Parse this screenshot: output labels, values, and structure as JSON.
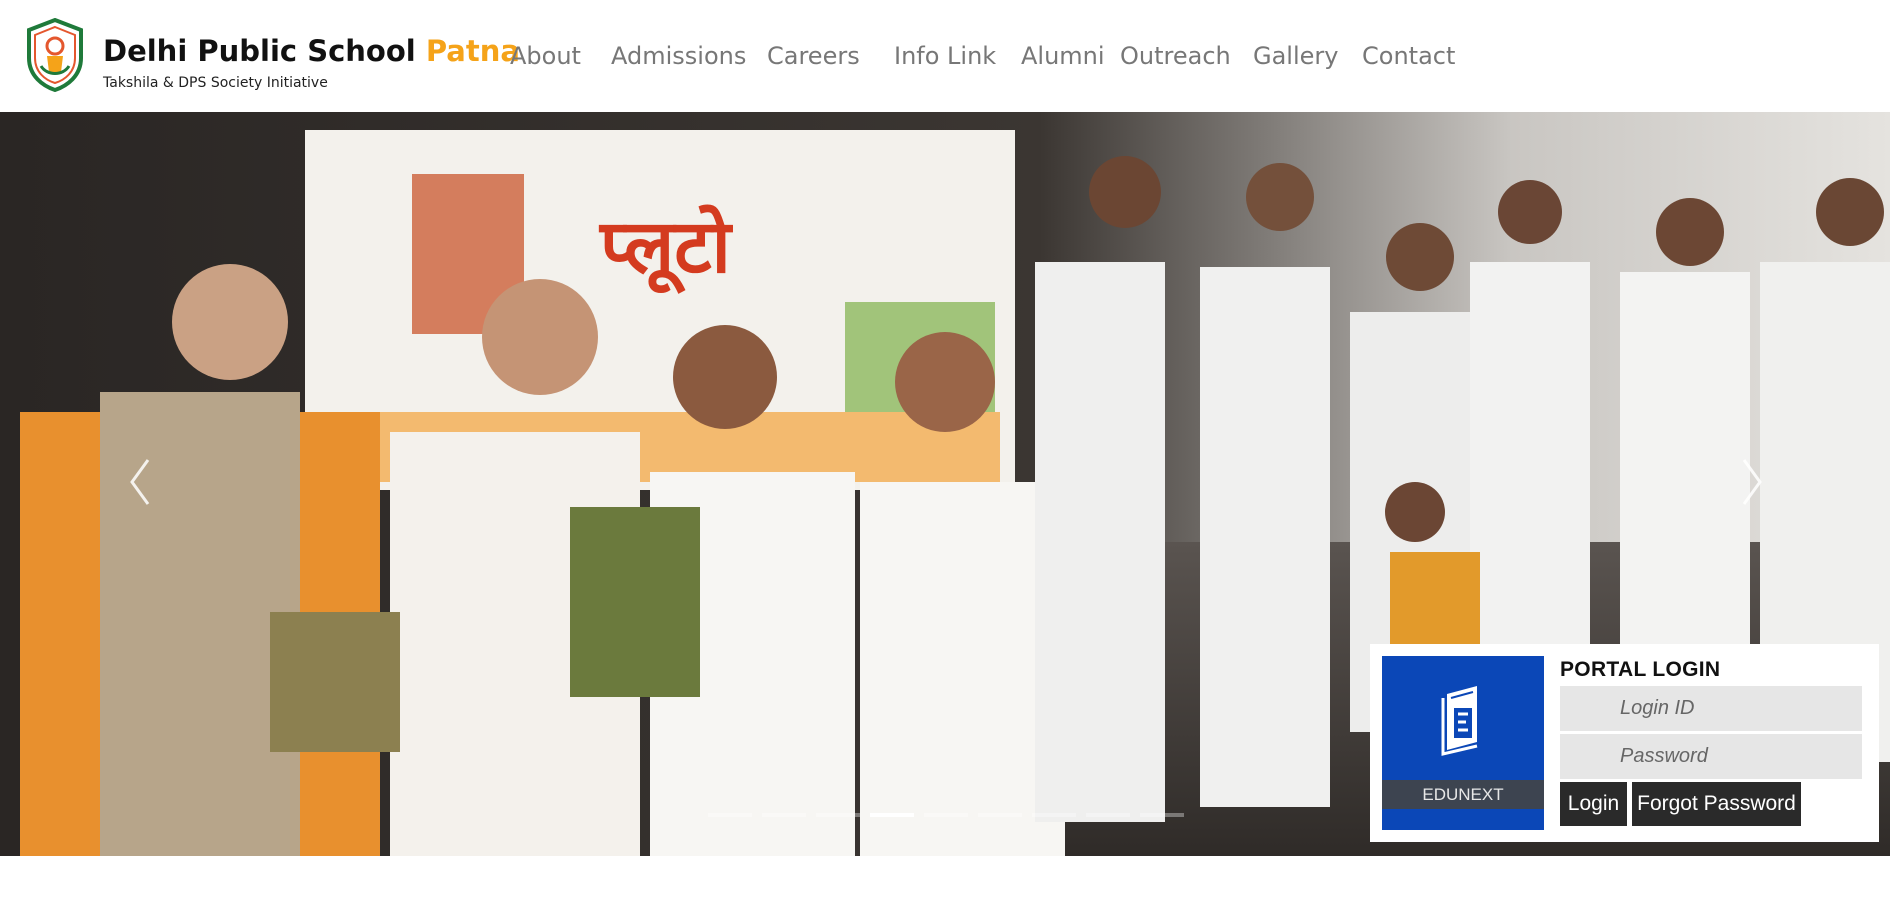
{
  "header": {
    "school_name": "Delhi Public School",
    "school_city": "Patna",
    "tagline": "Takshila & DPS Society Initiative",
    "accent_color": "#f5a319"
  },
  "nav": {
    "items": [
      {
        "label": "About"
      },
      {
        "label": "Admissions"
      },
      {
        "label": "Careers"
      },
      {
        "label": "Info Link"
      },
      {
        "label": "Alumni"
      },
      {
        "label": "Outreach"
      },
      {
        "label": "Gallery"
      },
      {
        "label": "Contact"
      }
    ]
  },
  "hero": {
    "slide_count": 9,
    "active_slide": 3,
    "prev_icon": "chevron-left-icon",
    "next_icon": "chevron-right-icon"
  },
  "portal": {
    "title": "PORTAL LOGIN",
    "brand_label": "EDUNEXT",
    "brand_color": "#0b47b7",
    "login_id_placeholder": "Login ID",
    "password_placeholder": "Password",
    "login_label": "Login",
    "forgot_label": "Forgot Password"
  }
}
